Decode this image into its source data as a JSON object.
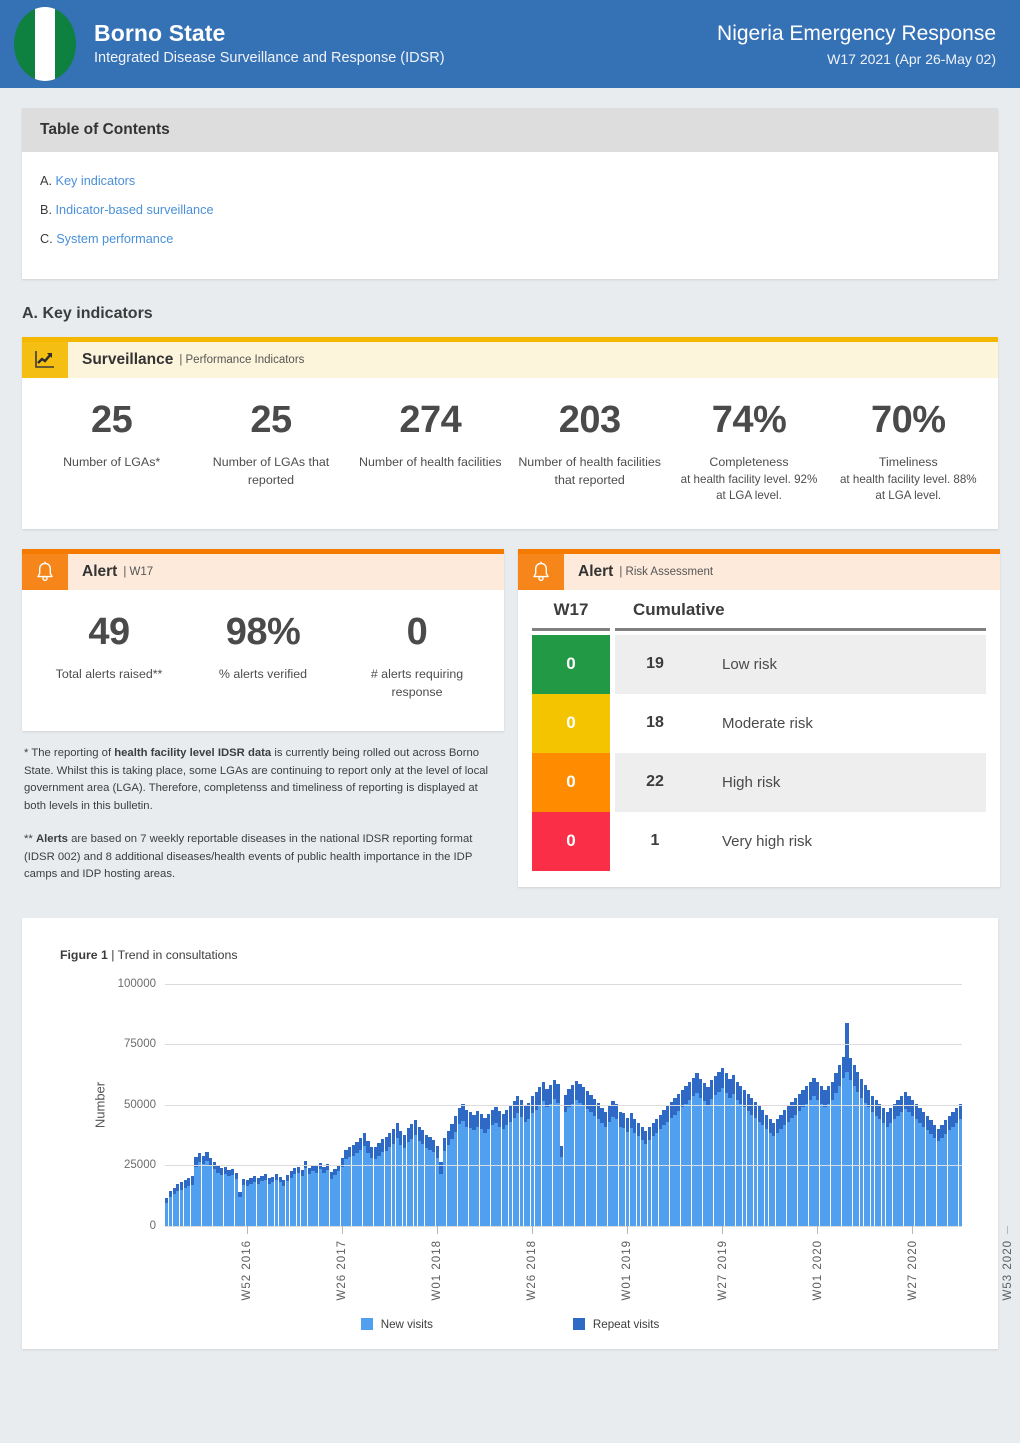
{
  "header": {
    "flag_icon": "nigeria-flag-icon",
    "state": "Borno State",
    "subtitle": "Integrated Disease Surveillance and Response (IDSR)",
    "right_title": "Nigeria Emergency Response",
    "right_period": "W17 2021 (Apr 26-May 02)",
    "bg_color": "#3571b5"
  },
  "toc": {
    "title": "Table of Contents",
    "items": [
      {
        "letter": "A.",
        "label": "Key indicators"
      },
      {
        "letter": "B.",
        "label": "Indicator-based surveillance"
      },
      {
        "letter": "C.",
        "label": "System performance"
      }
    ]
  },
  "sections": {
    "key_indicators_title": "A. Key indicators"
  },
  "surveillance": {
    "icon": "chart-trend-icon",
    "name": "Surveillance",
    "meta": "| Performance Indicators",
    "accent": "#f5b800",
    "stats": [
      {
        "value": "25",
        "label": "Number of\nLGAs*",
        "sub": ""
      },
      {
        "value": "25",
        "label": "Number of LGAs\nthat reported",
        "sub": ""
      },
      {
        "value": "274",
        "label": "Number of health\nfacilities",
        "sub": ""
      },
      {
        "value": "203",
        "label": "Number of health\nfacilities that\nreported",
        "sub": ""
      },
      {
        "value": "74%",
        "label": "Completeness",
        "sub": "at health facility level. 92% at LGA level."
      },
      {
        "value": "70%",
        "label": "Timeliness",
        "sub": "at health facility level. 88% at LGA level."
      }
    ]
  },
  "alert_w17": {
    "icon": "bell-icon",
    "name": "Alert",
    "meta": "| W17",
    "accent": "#f47b00",
    "stats": [
      {
        "value": "49",
        "label": "Total alerts raised**"
      },
      {
        "value": "98%",
        "label": "% alerts verified"
      },
      {
        "value": "0",
        "label": "# alerts requiring response"
      }
    ]
  },
  "alert_risk": {
    "icon": "bell-icon",
    "name": "Alert",
    "meta": "| Risk Assessment",
    "accent": "#f47b00",
    "columns": {
      "week": "W17",
      "cumulative": "Cumulative"
    },
    "rows": [
      {
        "week": "0",
        "cumulative": "19",
        "label": "Low risk",
        "color": "#229944"
      },
      {
        "week": "0",
        "cumulative": "18",
        "label": "Moderate risk",
        "color": "#f5c400"
      },
      {
        "week": "0",
        "cumulative": "22",
        "label": "High risk",
        "color": "#ff8c00"
      },
      {
        "week": "0",
        "cumulative": "1",
        "label": "Very high risk",
        "color": "#fa2e47"
      }
    ]
  },
  "footnotes": {
    "one_prefix": "* The reporting of ",
    "one_bold": "health facility level IDSR data",
    "one_rest": " is currently being rolled out across Borno State. Whilst this is taking place, some LGAs are continuing to report only at the level of local government area (LGA). Therefore, completenss and timeliness of reporting is displayed at both levels in this bulletin.",
    "two_prefix": "** ",
    "two_bold": "Alerts",
    "two_rest": " are based on 7 weekly reportable diseases in the national IDSR reporting format (IDSR 002) and 8 additional diseases/health events of public health importance in the IDP camps and IDP hosting areas."
  },
  "figure": {
    "caption_bold": "Figure 1",
    "caption_rest": " | Trend in consultations"
  },
  "chart_data": {
    "type": "bar",
    "stacked": true,
    "title": "Trend in consultations",
    "xlabel": "",
    "ylabel": "Number",
    "ylim": [
      0,
      100000
    ],
    "yticks": [
      0,
      25000,
      50000,
      75000,
      100000
    ],
    "ytick_labels": [
      "0",
      "25000",
      "50000",
      "75000",
      "100000"
    ],
    "grid": true,
    "legend_position": "bottom",
    "legend": [
      {
        "name": "New visits",
        "color": "#51a0f0"
      },
      {
        "name": "Repeat visits",
        "color": "#2f69c6"
      }
    ],
    "xtick_labels": [
      "W52 2016",
      "W26 2017",
      "W01 2018",
      "W26 2018",
      "W01 2019",
      "W27 2019",
      "W01 2020",
      "W27 2020",
      "W53 2020"
    ],
    "xtick_positions": [
      22,
      48,
      74,
      100,
      126,
      152,
      178,
      204,
      230
    ],
    "series": [
      {
        "name": "New visits",
        "color": "#51a0f0",
        "values": [
          9500,
          12000,
          13000,
          14500,
          15000,
          15500,
          16500,
          17000,
          24500,
          26500,
          25500,
          27000,
          25000,
          23500,
          22000,
          21000,
          21500,
          20500,
          21000,
          19500,
          12000,
          17000,
          16500,
          17500,
          18000,
          17500,
          18500,
          19000,
          17500,
          18000,
          19000,
          18000,
          16500,
          18500,
          20000,
          21500,
          22000,
          20500,
          24000,
          21500,
          22500,
          22000,
          23500,
          22000,
          23000,
          19500,
          21000,
          22500,
          24500,
          27500,
          28500,
          29000,
          30000,
          31500,
          33000,
          30000,
          28000,
          27500,
          29000,
          30500,
          31000,
          32500,
          34000,
          36500,
          33500,
          32000,
          34500,
          36000,
          37500,
          35000,
          34000,
          32000,
          31500,
          30500,
          28000,
          21500,
          31000,
          33500,
          36000,
          39000,
          42000,
          43500,
          41000,
          40500,
          39500,
          41000,
          40000,
          38500,
          40000,
          41500,
          42500,
          41000,
          40000,
          41500,
          43000,
          44500,
          46500,
          45000,
          43000,
          44000,
          46500,
          48000,
          50000,
          51500,
          49000,
          50500,
          52500,
          51000,
          28500,
          47000,
          49000,
          50500,
          52000,
          51000,
          50000,
          48500,
          47000,
          45500,
          44000,
          42500,
          41000,
          43000,
          45000,
          44000,
          41000,
          40500,
          39000,
          40500,
          38500,
          37000,
          35500,
          34000,
          35500,
          37000,
          38500,
          40000,
          41500,
          43000,
          44500,
          46000,
          47500,
          49000,
          50500,
          52000,
          53500,
          55000,
          53000,
          51500,
          50000,
          52500,
          54000,
          55500,
          57000,
          55000,
          53000,
          54500,
          52000,
          50500,
          49000,
          47500,
          46000,
          44500,
          43000,
          41500,
          40000,
          38500,
          37000,
          38500,
          40000,
          41500,
          43000,
          44500,
          46000,
          47500,
          49000,
          50500,
          52000,
          53500,
          52000,
          50500,
          49000,
          50500,
          52000,
          55000,
          58000,
          61000,
          63500,
          60500,
          58000,
          55500,
          53000,
          51000,
          49000,
          47000,
          45500,
          44000,
          42500,
          41000,
          42500,
          44000,
          45500,
          47000,
          48500,
          47000,
          45500,
          44000,
          42500,
          41000,
          39500,
          38000,
          36500,
          35000,
          36500,
          38000,
          39500,
          41000,
          42500,
          44000
        ]
      },
      {
        "name": "Repeat visits",
        "color": "#2f69c6",
        "values": [
          2000,
          2500,
          2800,
          3000,
          3200,
          3400,
          3200,
          3500,
          4000,
          3800,
          3600,
          3500,
          3200,
          3000,
          2900,
          2800,
          2700,
          2600,
          2500,
          2400,
          2200,
          2300,
          2400,
          2300,
          2500,
          2400,
          2300,
          2500,
          2400,
          2300,
          2500,
          2400,
          2300,
          2500,
          2600,
          2500,
          2400,
          2600,
          2700,
          2600,
          2500,
          2700,
          2600,
          2500,
          2700,
          2600,
          2500,
          2700,
          3500,
          4000,
          4200,
          4500,
          4800,
          5000,
          5200,
          5000,
          4800,
          5000,
          5200,
          5400,
          5600,
          5800,
          6000,
          6200,
          5800,
          5600,
          6000,
          6200,
          6400,
          6000,
          5800,
          5600,
          5400,
          5200,
          5000,
          4800,
          5200,
          5600,
          6000,
          6400,
          6800,
          7000,
          6800,
          6600,
          6400,
          6600,
          6400,
          6200,
          6400,
          6600,
          6800,
          6600,
          6400,
          6600,
          6800,
          7000,
          7200,
          7000,
          6800,
          7000,
          7200,
          7400,
          7600,
          7800,
          7400,
          7600,
          7800,
          7600,
          4500,
          7200,
          7400,
          7600,
          7800,
          7600,
          7400,
          7200,
          7000,
          6800,
          6600,
          6400,
          6200,
          6400,
          6600,
          6400,
          6200,
          6000,
          5800,
          6000,
          5800,
          5600,
          5400,
          5200,
          5400,
          5600,
          5800,
          6000,
          6200,
          6400,
          6600,
          6800,
          7000,
          7200,
          7400,
          7600,
          7800,
          8000,
          7800,
          7600,
          7400,
          7600,
          7800,
          8000,
          8200,
          8000,
          7800,
          8000,
          7600,
          7400,
          7200,
          7000,
          6800,
          6600,
          6400,
          6200,
          6000,
          5800,
          5600,
          5800,
          6000,
          6200,
          6400,
          6600,
          6800,
          7000,
          7200,
          7400,
          7600,
          7800,
          7600,
          7400,
          7200,
          7400,
          7600,
          8000,
          8400,
          8800,
          20500,
          9000,
          8600,
          8200,
          7800,
          7400,
          7000,
          6800,
          6600,
          6400,
          6200,
          6000,
          6200,
          6400,
          6600,
          6800,
          7000,
          6800,
          6600,
          6400,
          6200,
          6000,
          5800,
          5600,
          5400,
          5200,
          5400,
          5600,
          5800,
          6000,
          6200,
          6400
        ]
      }
    ]
  }
}
